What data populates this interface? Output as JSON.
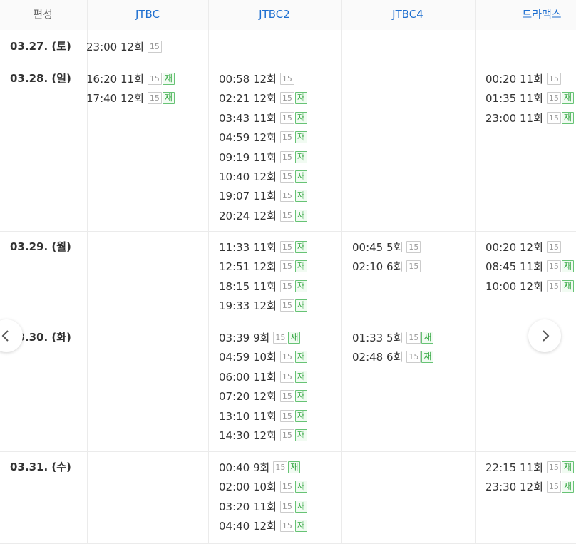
{
  "header": {
    "first_column": "편성",
    "channels": [
      "JTBC",
      "JTBC2",
      "JTBC4",
      "드라맥스"
    ]
  },
  "badges": {
    "rating": "15",
    "rerun": "재"
  },
  "rows": [
    {
      "date": "03.27. (토)",
      "cells": [
        [
          {
            "time": "23:00",
            "episode": "12회",
            "rerun": false
          }
        ],
        [],
        [],
        []
      ]
    },
    {
      "date": "03.28. (일)",
      "cells": [
        [
          {
            "time": "16:20",
            "episode": "11회",
            "rerun": true
          },
          {
            "time": "17:40",
            "episode": "12회",
            "rerun": true
          }
        ],
        [
          {
            "time": "00:58",
            "episode": "12회",
            "rerun": false
          },
          {
            "time": "02:21",
            "episode": "12회",
            "rerun": true
          },
          {
            "time": "03:43",
            "episode": "11회",
            "rerun": true
          },
          {
            "time": "04:59",
            "episode": "12회",
            "rerun": true
          },
          {
            "time": "09:19",
            "episode": "11회",
            "rerun": true
          },
          {
            "time": "10:40",
            "episode": "12회",
            "rerun": true
          },
          {
            "time": "19:07",
            "episode": "11회",
            "rerun": true
          },
          {
            "time": "20:24",
            "episode": "12회",
            "rerun": true
          }
        ],
        [],
        [
          {
            "time": "00:20",
            "episode": "11회",
            "rerun": false
          },
          {
            "time": "01:35",
            "episode": "11회",
            "rerun": true
          },
          {
            "time": "23:00",
            "episode": "11회",
            "rerun": true
          }
        ]
      ]
    },
    {
      "date": "03.29. (월)",
      "cells": [
        [],
        [
          {
            "time": "11:33",
            "episode": "11회",
            "rerun": true
          },
          {
            "time": "12:51",
            "episode": "12회",
            "rerun": true
          },
          {
            "time": "18:15",
            "episode": "11회",
            "rerun": true
          },
          {
            "time": "19:33",
            "episode": "12회",
            "rerun": true
          }
        ],
        [
          {
            "time": "00:45",
            "episode": "5회",
            "rerun": false
          },
          {
            "time": "02:10",
            "episode": "6회",
            "rerun": false
          }
        ],
        [
          {
            "time": "00:20",
            "episode": "12회",
            "rerun": false
          },
          {
            "time": "08:45",
            "episode": "11회",
            "rerun": true
          },
          {
            "time": "10:00",
            "episode": "12회",
            "rerun": true
          }
        ]
      ]
    },
    {
      "date": "03.30. (화)",
      "cells": [
        [],
        [
          {
            "time": "03:39",
            "episode": "9회",
            "rerun": true
          },
          {
            "time": "04:59",
            "episode": "10회",
            "rerun": true
          },
          {
            "time": "06:00",
            "episode": "11회",
            "rerun": true
          },
          {
            "time": "07:20",
            "episode": "12회",
            "rerun": true
          },
          {
            "time": "13:10",
            "episode": "11회",
            "rerun": true
          },
          {
            "time": "14:30",
            "episode": "12회",
            "rerun": true
          }
        ],
        [
          {
            "time": "01:33",
            "episode": "5회",
            "rerun": true
          },
          {
            "time": "02:48",
            "episode": "6회",
            "rerun": true
          }
        ],
        []
      ]
    },
    {
      "date": "03.31. (수)",
      "cells": [
        [],
        [
          {
            "time": "00:40",
            "episode": "9회",
            "rerun": true
          },
          {
            "time": "02:00",
            "episode": "10회",
            "rerun": true
          },
          {
            "time": "03:20",
            "episode": "11회",
            "rerun": true
          },
          {
            "time": "04:40",
            "episode": "12회",
            "rerun": true
          }
        ],
        [],
        [
          {
            "time": "22:15",
            "episode": "11회",
            "rerun": true
          },
          {
            "time": "23:30",
            "episode": "12회",
            "rerun": true
          }
        ]
      ]
    }
  ],
  "nav": {
    "prev_icon": "chevron-left-icon",
    "next_icon": "chevron-right-icon"
  },
  "colors": {
    "channel_header": "#1e6fd0",
    "rerun_badge": "#2fa53d",
    "rating_badge": "#999999",
    "grid": "#ebebeb"
  }
}
